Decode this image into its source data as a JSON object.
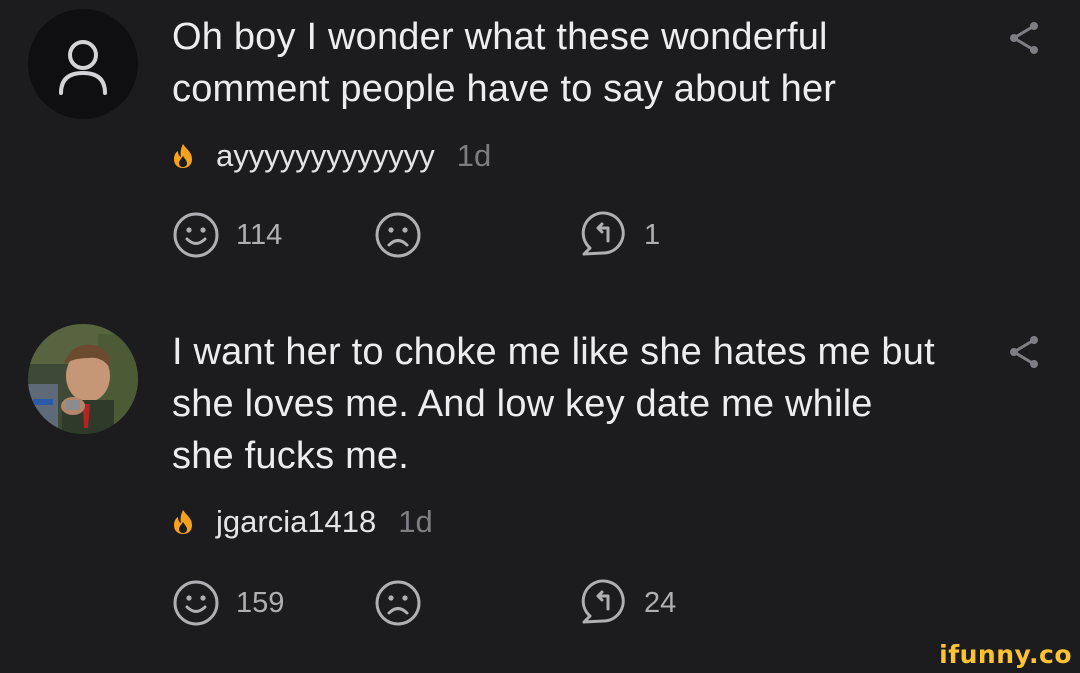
{
  "comments": [
    {
      "text": "Oh boy I wonder what these wonderful comment people have to say about her",
      "username": "ayyyyyyyyyyyyy",
      "time": "1d",
      "smile_count": "114",
      "reply_count": "1",
      "avatar": "default-user-icon"
    },
    {
      "text": "I want her to choke me like she hates me but she loves me. And low key date me while she fucks me.",
      "username": "jgarcia1418",
      "time": "1d",
      "smile_count": "159",
      "reply_count": "24",
      "avatar": "user-photo-avatar"
    }
  ],
  "watermark": "ifunny.co",
  "colors": {
    "background": "#1c1c1f",
    "text": "#ededed",
    "muted": "#7d7d82",
    "flame": "#f7a21b",
    "brand": "#ffc32e"
  }
}
